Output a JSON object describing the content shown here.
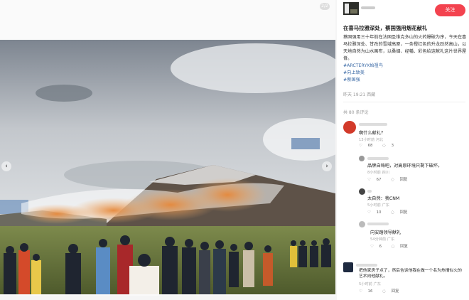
{
  "media": {
    "counter": "2/2",
    "prev_arrow": "‹",
    "next_arrow": "›",
    "colors": {
      "sky": "#c9ccd0",
      "smoke": "#e59a4c",
      "mountain": "#6b5a4a",
      "grass": "#6e7c3e"
    }
  },
  "side": {
    "follow_label": "关注",
    "title": "在喜马拉雅深处，蔡国强用烟花献礼",
    "body": "蔡国强用三十年前在法国圣维克多山的火药爆破为序，今天在喜马拉雅深处、甘孜的雪域高原，一条橙红色的升龙跃然高山，以天地自然为山水画布，以桑烟、经幡、彩色给这献礼这片世界屋脊。",
    "tags": [
      "#ARCTERYX始祖鸟",
      "#向上致美",
      "#蔡国强"
    ],
    "meta": "昨天 19:21 西藏",
    "comment_count": "共 80 条评论",
    "comments": [
      {
        "text": "啊什么献礼？",
        "meta": "13小时前 河北",
        "likes": "68",
        "replies": "3"
      },
      {
        "text": "品牌自嗨吧，对高原环境只剩下破坏。",
        "meta": "8小时前 四川",
        "likes": "67",
        "replies": "回复"
      },
      {
        "text": "太自然：我CNM",
        "meta": "5小时前 广东",
        "likes": "10",
        "replies": "回复"
      },
      {
        "text": "向安踏领导献礼",
        "meta": "54分钟前 广东",
        "likes": "6",
        "replies": "回复"
      },
      {
        "text": "把他家房子点了，然后告诉他我在做一个名为热情似火的艺术向他献礼。",
        "meta": "5小时前 广东",
        "likes": "16",
        "replies": "回复"
      }
    ]
  }
}
